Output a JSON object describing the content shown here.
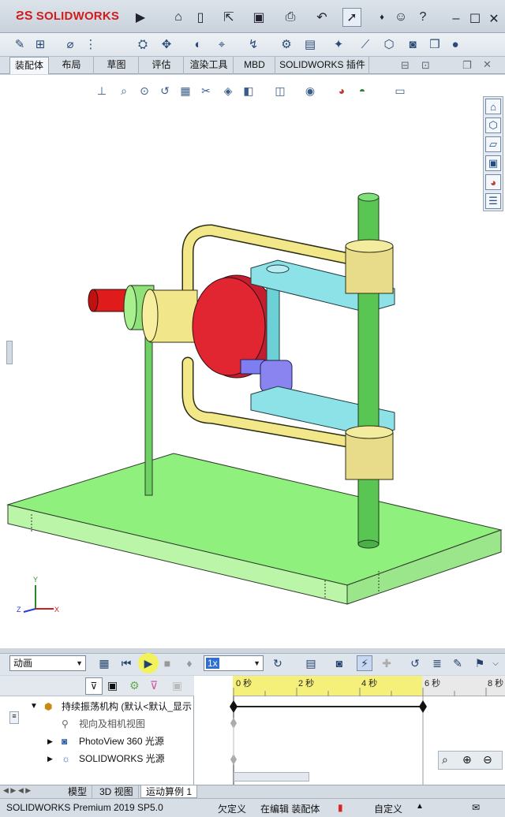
{
  "app": {
    "logo": "SOLIDWORKS"
  },
  "tabs": [
    "装配体",
    "布局",
    "草图",
    "评估",
    "渲染工具",
    "MBD",
    "SOLIDWORKS 插件"
  ],
  "animation": {
    "study_type": "动画",
    "speed": "1x"
  },
  "tree": {
    "root": "持续振荡机构 (默认<默认_显示",
    "items": [
      "视向及相机视图",
      "PhotoView 360 光源",
      "SOLIDWORKS 光源"
    ]
  },
  "timeline": {
    "ticks": [
      "0 秒",
      "2 秒",
      "4 秒",
      "6 秒",
      "8 秒"
    ]
  },
  "triad": {
    "x": "X",
    "y": "Y",
    "z": "Z"
  },
  "bottom_tabs": [
    "模型",
    "3D 视图",
    "运动算例 1"
  ],
  "status": {
    "product": "SOLIDWORKS Premium 2019 SP5.0",
    "state": "欠定义",
    "editing": "在编辑 装配体",
    "custom": "自定义"
  }
}
